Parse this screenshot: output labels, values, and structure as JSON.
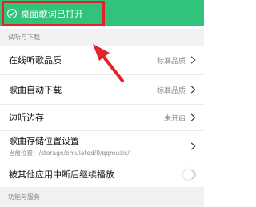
{
  "toast": {
    "text": "桌面歌词已打开",
    "icon": "check-circle-icon"
  },
  "sections": [
    {
      "title": "试听与下载"
    },
    {
      "title": "功能与服务"
    }
  ],
  "rows": {
    "online_quality": {
      "label": "在线听歌品质",
      "value": "标准品质"
    },
    "auto_download": {
      "label": "歌曲自动下载",
      "value": "标准品质"
    },
    "listen_cache": {
      "label": "边听边存",
      "value": "未开启"
    },
    "storage": {
      "label": "歌曲存储位置设置",
      "sub": "当前位置：/storage/emulated/0/qqmusic/"
    },
    "resume": {
      "label": "被其他应用中断后继续播放",
      "toggle": "off"
    }
  },
  "colors": {
    "accent": "#31c27c",
    "annotation": "#e2242a"
  }
}
